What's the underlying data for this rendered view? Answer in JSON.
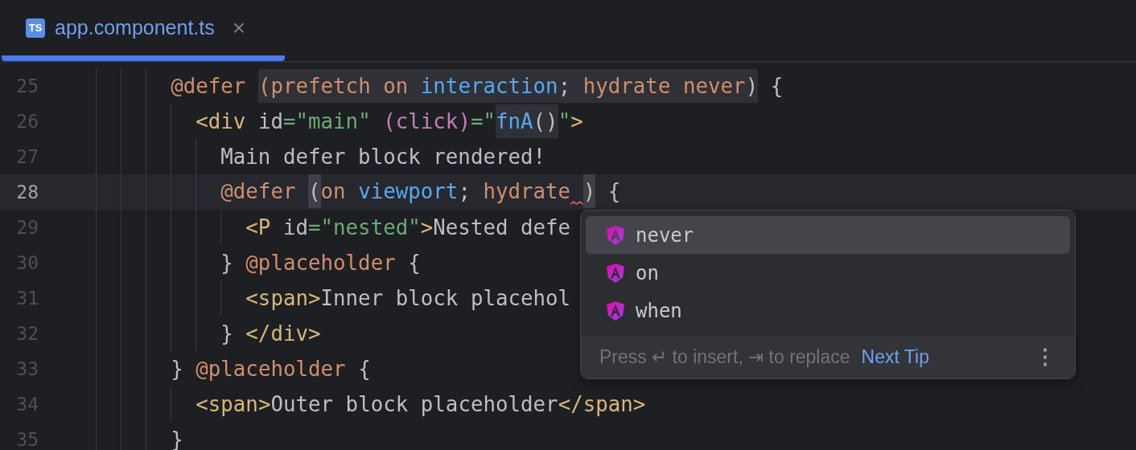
{
  "tab": {
    "icon_text": "TS",
    "label": "app.component.ts",
    "close": "×",
    "selected": true
  },
  "lines": [
    {
      "number": "25",
      "current": false,
      "tokens": [
        {
          "text": "@defer ",
          "kind": "keyword"
        },
        {
          "text": "(",
          "kind": "keyword",
          "highlighted": true
        },
        {
          "text": "prefetch on ",
          "kind": "keyword",
          "highlighted": true
        },
        {
          "text": "interaction",
          "kind": "ident",
          "highlighted": true
        },
        {
          "text": "; ",
          "kind": "plain",
          "highlighted": true
        },
        {
          "text": "hydrate never",
          "kind": "keyword",
          "highlighted": true
        },
        {
          "text": ")",
          "kind": "plain",
          "highlighted": true
        },
        {
          "text": " {",
          "kind": "plain"
        }
      ],
      "children": [
        {
          "number": "26",
          "current": false,
          "tokens": [
            {
              "text": "<div",
              "kind": "tag"
            },
            {
              "text": " id",
              "kind": "plain"
            },
            {
              "text": "=\"main\" ",
              "kind": "string"
            },
            {
              "text": "(click)",
              "kind": "event"
            },
            {
              "text": "=\"",
              "kind": "string"
            },
            {
              "text": "fnA",
              "kind": "ident",
              "highlighted": true
            },
            {
              "text": "()",
              "kind": "plain",
              "highlighted": true
            },
            {
              "text": "\"",
              "kind": "string"
            },
            {
              "text": ">",
              "kind": "tag"
            }
          ],
          "children": [
            {
              "number": "27",
              "current": false,
              "tokens": [
                {
                  "text": "Main defer block rendered!",
                  "kind": "plain"
                }
              ]
            },
            {
              "number": "28",
              "current": true,
              "tokens": [
                {
                  "text": "@defer ",
                  "kind": "keyword"
                },
                {
                  "text": "(",
                  "kind": "plain",
                  "highlighted": true
                },
                {
                  "text": "on ",
                  "kind": "keyword"
                },
                {
                  "text": "viewport",
                  "kind": "ident"
                },
                {
                  "text": "; ",
                  "kind": "plain"
                },
                {
                  "text": "hydrate",
                  "kind": "keyword",
                  "error_after": true
                },
                {
                  "text": ")",
                  "kind": "plain",
                  "highlighted": true
                },
                {
                  "text": " {",
                  "kind": "plain"
                }
              ],
              "children": [
                {
                  "number": "29",
                  "current": false,
                  "tokens": [
                    {
                      "text": "<P",
                      "kind": "tag"
                    },
                    {
                      "text": " id",
                      "kind": "plain"
                    },
                    {
                      "text": "=\"nested\"",
                      "kind": "string"
                    },
                    {
                      "text": ">",
                      "kind": "tag"
                    },
                    {
                      "text": "Nested defe",
                      "kind": "plain"
                    }
                  ]
                }
              ]
            },
            {
              "number": "30",
              "current": false,
              "tokens": [
                {
                  "text": "} ",
                  "kind": "plain"
                },
                {
                  "text": "@placeholder",
                  "kind": "keyword"
                },
                {
                  "text": " {",
                  "kind": "plain"
                }
              ],
              "children": [
                {
                  "number": "31",
                  "current": false,
                  "tokens": [
                    {
                      "text": "<span>",
                      "kind": "tag"
                    },
                    {
                      "text": "Inner block placehol",
                      "kind": "plain"
                    }
                  ]
                }
              ]
            },
            {
              "number": "32",
              "current": false,
              "tokens": [
                {
                  "text": "} ",
                  "kind": "plain"
                },
                {
                  "text": "</div>",
                  "kind": "tag"
                }
              ]
            }
          ]
        }
      ]
    },
    {
      "number": "33",
      "current": false,
      "tokens": [
        {
          "text": "} ",
          "kind": "plain"
        },
        {
          "text": "@placeholder",
          "kind": "keyword"
        },
        {
          "text": " {",
          "kind": "plain"
        }
      ],
      "children": [
        {
          "number": "34",
          "current": false,
          "tokens": [
            {
              "text": "<span>",
              "kind": "tag"
            },
            {
              "text": "Outer block placeholder",
              "kind": "plain"
            },
            {
              "text": "</span>",
              "kind": "tag"
            }
          ]
        }
      ]
    },
    {
      "number": "35",
      "current": false,
      "tokens": [
        {
          "text": "}",
          "kind": "plain"
        }
      ]
    }
  ],
  "completion": {
    "items": [
      {
        "label": "never",
        "selected": true
      },
      {
        "label": "on",
        "selected": false
      },
      {
        "label": "when",
        "selected": false
      }
    ],
    "hint": "Press ↵ to insert, ⇥ to replace",
    "link": "Next Tip",
    "menu": "⋮"
  }
}
